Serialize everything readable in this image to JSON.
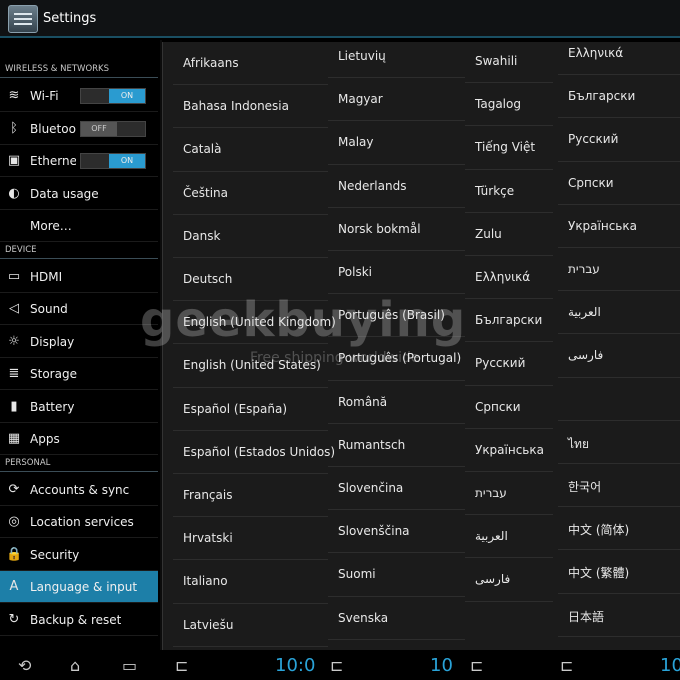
{
  "app": {
    "title": "Settings"
  },
  "sidebar": {
    "sections": [
      {
        "header": "WIRELESS & NETWORKS",
        "items": [
          {
            "label": "Wi-Fi",
            "icon": "wifi-icon",
            "toggle": "ON"
          },
          {
            "label": "Bluetooth",
            "icon": "bluetooth-icon",
            "toggle": "OFF"
          },
          {
            "label": "Ethernet",
            "icon": "ethernet-icon",
            "toggle": "ON"
          },
          {
            "label": "Data usage",
            "icon": "data-usage-icon"
          },
          {
            "label": "More…",
            "icon": ""
          }
        ]
      },
      {
        "header": "DEVICE",
        "items": [
          {
            "label": "HDMI",
            "icon": "hdmi-icon"
          },
          {
            "label": "Sound",
            "icon": "sound-icon"
          },
          {
            "label": "Display",
            "icon": "display-icon"
          },
          {
            "label": "Storage",
            "icon": "storage-icon"
          },
          {
            "label": "Battery",
            "icon": "battery-icon"
          },
          {
            "label": "Apps",
            "icon": "apps-icon"
          }
        ]
      },
      {
        "header": "PERSONAL",
        "items": [
          {
            "label": "Accounts & sync",
            "icon": "sync-icon"
          },
          {
            "label": "Location services",
            "icon": "location-icon"
          },
          {
            "label": "Security",
            "icon": "lock-icon"
          },
          {
            "label": "Language & input",
            "icon": "language-icon",
            "selected": true
          },
          {
            "label": "Backup & reset",
            "icon": "backup-icon"
          }
        ]
      }
    ]
  },
  "languages": {
    "col1": [
      "Afrikaans",
      "Bahasa Indonesia",
      "Català",
      "Čeština",
      "Dansk",
      "Deutsch",
      "English (United Kingdom)",
      "English (United States)",
      "Español (España)",
      "Español (Estados Unidos)",
      "Français",
      "Hrvatski",
      "Italiano",
      "Latviešu"
    ],
    "col2": [
      "Lietuvių",
      "Magyar",
      "Malay",
      "Nederlands",
      "Norsk bokmål",
      "Polski",
      "Português (Brasil)",
      "Português (Portugal)",
      "Română",
      "Rumantsch",
      "Slovenčina",
      "Slovenščina",
      "Suomi",
      "Svenska"
    ],
    "col3": [
      "Swahili",
      "Tagalog",
      "Tiếng Việt",
      "Türkçe",
      "Zulu",
      "Ελληνικά",
      "Български",
      "Русский",
      "Српски",
      "Українська",
      "עברית",
      "العربية",
      "فارسی"
    ],
    "col4": [
      "Ελληνικά",
      "Български",
      "Русский",
      "Српски",
      "Українська",
      "עברית",
      "العربية",
      "فارسی",
      "",
      "ไทย",
      "한국어",
      "中文 (简体)",
      "中文 (繁體)",
      "日本語"
    ]
  },
  "watermark": {
    "brand": "geekbuying",
    "tagline": "Free shipping worldwide"
  },
  "navbar": {
    "clock": "10:0",
    "clock2": "10",
    "clock3": "10"
  },
  "colors": {
    "accent": "#1d7fa8",
    "toggle_on": "#2a9bd0",
    "clock": "#2aa3d8"
  }
}
